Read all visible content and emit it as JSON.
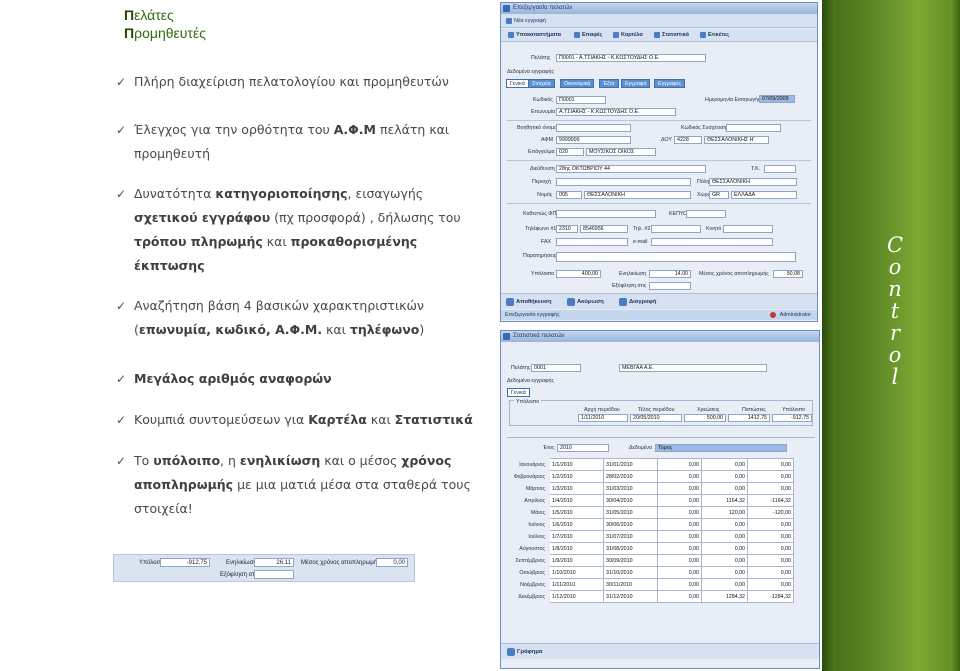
{
  "slide": {
    "title_lines": [
      {
        "first": "Π",
        "rest": "ελάτες"
      },
      {
        "first": "Π",
        "rest": "ρομηθευτές"
      }
    ],
    "bullets": [
      {
        "line1": "Πλήρη διαχείριση πελατολογίου και προμηθευτών",
        "line2": ""
      },
      {
        "line1_a": "Έλεγχος για την ορθότητα του ",
        "line1_b": "Α.Φ.Μ",
        "line1_c": " πελάτη και",
        "line2": "προμηθευτή"
      },
      {
        "line1_a": "Δυνατότητα  ",
        "line1_b": "κατηγοριοποίησης",
        "line1_c": ", εισαγωγής",
        "line2_a": "σχετικού εγγράφου",
        "line2_b": " (πχ προσφορά) , δήλωσης του",
        "line3_a": "τρόπου πληρωμής",
        "line3_b": " και  ",
        "line3_c": "προκαθορισμένης",
        "line4": "έκπτωσης"
      },
      {
        "line1": "Αναζήτηση βάση 4 βασικών χαρακτηριστικών",
        "line2_a": "(",
        "line2_b": "επωνυμία, κωδικό, Α.Φ.Μ.",
        "line2_c": " και ",
        "line2_d": "τηλέφωνο",
        "line2_e": ")"
      },
      {
        "line1": "Μεγάλος αριθμός αναφορών"
      },
      {
        "line1_a": "Κουμπιά  συντομεύσεων για ",
        "line1_b": "Καρτέλα",
        "line1_c": " και ",
        "line1_d": "Στατιστικά"
      },
      {
        "line1_a": "Το ",
        "line1_b": "υπόλοιπο",
        "line1_c": ", η ",
        "line1_d": "ενηλικίωση",
        "line1_e": " και ο μέσος ",
        "line1_f": "χρόνος",
        "line2_a": "αποπληρωμής",
        "line2_b": " με μια ματιά  μέσα στα σταθερά τους",
        "line3": "στοιχεία!"
      }
    ],
    "check_glyph": "✓",
    "control_letters": [
      "C",
      "o",
      "n",
      "t",
      "r",
      "o",
      "l"
    ],
    "mini_bar": {
      "balance_label": "Υπόλοιπο",
      "balance_value": "-912,75",
      "aging_label": "Ενηλικίωση",
      "aging_value": "26,11",
      "avg_label": "Μέσος χρόνος αποπληρωμής",
      "avg_value": "0,00",
      "settle_label": "Εξόφληση στις"
    }
  },
  "window1": {
    "title": "Επεξεργασία πελατών",
    "toolbar_new": "Νέα εγγραφή",
    "toolbar": [
      "Υποκαταστήματα",
      "Επαφές",
      "Καρτέλα",
      "Στατιστικά",
      "Ετικέτες"
    ],
    "customer_label": "Πελάτης",
    "customer_value": "Π0001 - Α.ΤΣΙΑΚΗΣ - Κ.ΚΩΣΤΟΥΔΗΣ Ο.Ε.",
    "record_data": "Δεδομένα εγγραφής",
    "tabs": [
      "Γενικά",
      "Στοιχεία",
      "Οικονομικά",
      "Έξτα",
      "Εγγραφα",
      "Εγγραφές"
    ],
    "code_label": "Κωδικός",
    "code_value": "Π0001",
    "date_label": "Ημερομηνία Εισαγωγής",
    "date_value": "07/09/2009",
    "name_label": "Επωνυμία",
    "name_value": "Α.ΤΣΙΑΚΗΣ - Κ.ΚΩΣΤΟΥΔΗΣ Ο.Ε.",
    "alt_label": "Βοηθητικό όνομα",
    "sys_code_label": "Κωδικός Συσχέτισης",
    "afm_label": "ΑΦΜ",
    "afm_value": "9999999",
    "doy_label": "ΔΟΥ",
    "doy_code": "4228",
    "doy_value": "ΘΕΣΣΑΛΟΝΙΚΗΣ Η'",
    "job_label": "Επάγγελμα",
    "job_code": "020",
    "job_value": "ΜΟΥΣΙΚΟΣ ΟΙΚΟΣ",
    "address_label": "Διεύθυνση",
    "address_value": "28ης ΟΚΤΩΒΡΙΟΥ  44",
    "zip_label": "Τ.Κ.",
    "area_label": "Περιοχή",
    "city_label": "Πόλη",
    "city_value": "ΘΕΣΣΑΛΟΝΙΚΗ",
    "county_label": "Νομός",
    "county_code": "005",
    "county_value": "ΘΕΣΣΑΛΟΝΙΚΗ",
    "country_label": "Χώρα",
    "country_code": "GR",
    "country_value": "ΕΛΛΑΔΑ",
    "vat_label": "Καθεστώς ΦΠΑ",
    "kepyo_label": "ΚΕΠΥΟ",
    "phone_label": "Τηλέφωνο #1",
    "phone_code": "2310",
    "phone_value": "8546956",
    "phone2_label": "Τηλ. #2",
    "mobile_label": "Κινητό",
    "fax_label": "FAX",
    "email_label": "e-mail",
    "notes_label": "Παρατηρήσεις",
    "balance_label": "Υπόλοιπο",
    "balance_value": "400,00",
    "aging_label": "Ενηλικίωση",
    "aging_value": "14,00",
    "avg_label": "Μέσος χρόνος αποπληρωμής",
    "avg_value": "50,08",
    "settle_label": "Εξόφληση στις",
    "btn_save": "Αποθήκευση",
    "btn_cancel": "Ακύρωση",
    "btn_delete": "Διαγραφή",
    "status_left": "Επεξεργασία εγγραφής",
    "status_user": "Administrator"
  },
  "window2": {
    "title": "Στατιστικά πελατών",
    "customer_label": "Πελάτης",
    "customer_value": "0001",
    "customer_name": "ΜΕΒΓΑΑ Α.Ε.",
    "record_data": "Δεδομένα εγγραφής",
    "tab": "Γενικά",
    "summary_title": "Υπόλοιπο",
    "summary_headers": [
      "Αρχή περιόδου",
      "Τέλος περιόδου",
      "Χρεώσεις",
      "Πιστώσεις",
      "Υπόλοιπο"
    ],
    "summary_values": [
      "1/11/2010",
      "20/05/2010",
      "500,00",
      "1412,75",
      "-912,75"
    ],
    "year_label": "Έτος",
    "year_value": "2010",
    "type_label": "Δεδομένα",
    "type_value": "Τύρος",
    "months": [
      {
        "m": "Ιανουάριος",
        "s": "1/1/2010",
        "e": "31/01/2010",
        "c": "0,00",
        "p": "0,00",
        "b": "0,00"
      },
      {
        "m": "Φεβρουάριος",
        "s": "1/2/2010",
        "e": "28/02/2010",
        "c": "0,00",
        "p": "0,00",
        "b": "0,00"
      },
      {
        "m": "Μάρτιος",
        "s": "1/3/2010",
        "e": "31/03/2010",
        "c": "0,00",
        "p": "0,00",
        "b": "0,00"
      },
      {
        "m": "Απρίλιος",
        "s": "1/4/2010",
        "e": "30/04/2010",
        "c": "0,00",
        "p": "1164,32",
        "b": "-1164,32"
      },
      {
        "m": "Μάιος",
        "s": "1/5/2010",
        "e": "31/05/2010",
        "c": "0,00",
        "p": "120,00",
        "b": "-120,00"
      },
      {
        "m": "Ιούνιος",
        "s": "1/6/2010",
        "e": "30/06/2010",
        "c": "0,00",
        "p": "0,00",
        "b": "0,00"
      },
      {
        "m": "Ιούλιος",
        "s": "1/7/2010",
        "e": "31/07/2010",
        "c": "0,00",
        "p": "0,00",
        "b": "0,00"
      },
      {
        "m": "Αύγουστος",
        "s": "1/8/2010",
        "e": "31/08/2010",
        "c": "0,00",
        "p": "0,00",
        "b": "0,00"
      },
      {
        "m": "Σεπτέμβριος",
        "s": "1/9/2010",
        "e": "30/09/2010",
        "c": "0,00",
        "p": "0,00",
        "b": "0,00"
      },
      {
        "m": "Οκτώβριος",
        "s": "1/10/2010",
        "e": "31/10/2010",
        "c": "0,00",
        "p": "0,00",
        "b": "0,00"
      },
      {
        "m": "Νοέμβριος",
        "s": "1/11/2010",
        "e": "30/11/2010",
        "c": "0,00",
        "p": "0,00",
        "b": "0,00"
      },
      {
        "m": "Δεκέμβριος",
        "s": "1/12/2010",
        "e": "31/12/2010",
        "c": "0,00",
        "p": "1284,32",
        "b": "-1284,32"
      }
    ],
    "btn_chart": "Γράφημα"
  }
}
